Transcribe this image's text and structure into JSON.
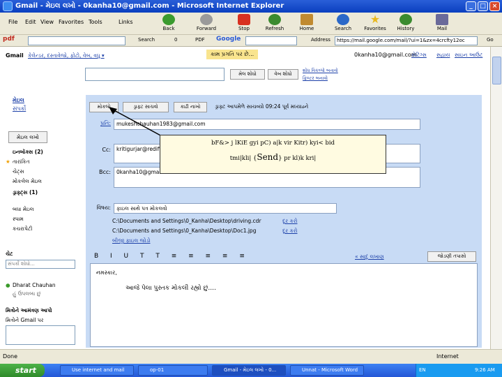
{
  "window": {
    "title": "Gmail - મેઇલ લખો - 0kanha10@gmail.com - Microsoft Internet Explorer",
    "controls": [
      "_",
      "□",
      "×"
    ]
  },
  "menubar": {
    "items": [
      "File",
      "Edit",
      "View",
      "Favorites",
      "Tools",
      "Links"
    ],
    "toolbar": [
      {
        "label": "Back",
        "icon": "back-arrow-icon",
        "color": "#3b9b2f"
      },
      {
        "label": "Forward",
        "icon": "forward-arrow-icon",
        "color": "#9a9a9a"
      },
      {
        "label": "Stop",
        "icon": "stop-icon",
        "color": "#d83020"
      },
      {
        "label": "Refresh",
        "icon": "refresh-icon",
        "color": "#3b8b2f"
      },
      {
        "label": "Home",
        "icon": "home-icon",
        "color": "#c08a30"
      },
      {
        "label": "Search",
        "icon": "search-icon",
        "color": "#2a68c8"
      },
      {
        "label": "Favorites",
        "icon": "favorites-star-icon",
        "color": "#e8b820"
      },
      {
        "label": "History",
        "icon": "history-icon",
        "color": "#3b8b2f"
      },
      {
        "label": "Mail",
        "icon": "mail-icon",
        "color": "#6a6a9a"
      }
    ]
  },
  "googlebar": {
    "pdf_label": "pdf",
    "search_label": "Search",
    "pdf_count": "0",
    "pdf_btn": "PDF",
    "google_label": "Google",
    "address_label": "Address",
    "address_value": "https://mail.google.com/mail/?ui=1&zx=4crcfty12oc",
    "go_label": "Go"
  },
  "gmail_header": {
    "brand": "Gmail",
    "nav": "કેલેન્ડર, દસ્તાવેજો, ફોટો, વેબ, વધુ ▾",
    "loading": "કામ પ્રગતિ પર છે...",
    "account": "0kanha10@gmail.com",
    "links": [
      "સેટિંગ્સ",
      "સહાય",
      "સાઇન આઉટ"
    ],
    "search_mail_btn": "મેલ શોધો",
    "search_web_btn": "વેબ શોધો",
    "search_options": "શોધ વિકલ્પો બતાવો",
    "create_filter": "ફિલ્ટર બનાવો"
  },
  "sidebar": {
    "top": [
      "મેઇલ",
      "સંપર્કો"
    ],
    "compose_btn": "મેઇલ લખો",
    "folders": [
      {
        "label": "ઇનબૉક્સ (2)",
        "bold": true
      },
      {
        "label": "તારાંકિત",
        "icon": "star-icon"
      },
      {
        "label": "ચેટ્સ"
      },
      {
        "label": "મોકલેલ મેઇલ"
      },
      {
        "label": "ડ્રાફ્ટ્સ (1)",
        "bold": true
      },
      {
        "label": "બધા મેઇલ"
      },
      {
        "label": "સ્પામ"
      },
      {
        "label": "કચરાપેટી"
      }
    ],
    "chat_title": "ચેટ",
    "chat_search": "સંપર્કો શોધો...",
    "chat_contacts": [
      {
        "name": "Dharat Chauhan",
        "status": "હું ઉપલબ્ધ છું"
      }
    ],
    "invite_title": "મિત્રોને આમંત્રણ આપો",
    "invite_sub": "મિત્રોને Gmail પર",
    "invite_btn": "આમંત્રણ મોકલો"
  },
  "compose": {
    "send_btn": "મોકલો",
    "save_btn": "ડ્રાફ્ટ સાચવો",
    "discard_btn": "કાઢી નાખો",
    "draft_info": "ડ્રાફ્ટ આપમેળે સાચવ્યો 09:24 પૂર્વ મધ્યાહ્ને",
    "to_label": "પ્રતિ:",
    "to_value": "mukeshchauhan1983@gmail.com",
    "cc_label": "Cc:",
    "cc_value": "kritigurjar@rediffmail.com",
    "bcc_label": "Bcc:",
    "bcc_value": "0kanha10@gmail.com",
    "subject_label": "વિષય:",
    "subject_value": "ફાઇલ સાથે પત્ર મોકલવો",
    "attachments": [
      {
        "path": "C:\\Documents and Settings\\0_Kanha\\Desktop\\driving.cdr",
        "action": "દૂર કરો"
      },
      {
        "path": "C:\\Documents and Settings\\0_Kanha\\Desktop\\Doc1.jpg",
        "action": "દૂર કરો"
      }
    ],
    "attach_more": "બીજી ફાઇલ જોડો",
    "spell_check": "જોડણી તપાસો",
    "plain_text": "« સાદું લખાણ",
    "body_line1": "નમસ્કાર,",
    "body_line2": "આજે પેલા પુસ્તક મોકલી રહ્યો છું...."
  },
  "tooltip": {
    "line1": "bF&> j lKiE gyi pC) a|k vir Kitr) kyi< bid",
    "line2_pre": "tmi|kli| {",
    "line2_send": "Send",
    "line2_post": "} pr kl)k kri|"
  },
  "statusbar": {
    "left": "Done",
    "right": "Internet"
  },
  "taskbar": {
    "start": "start",
    "tasks": [
      "Use internet and mail",
      "op-01",
      "Gmail - મેઇલ લખો - 0...",
      "Unnat - Microsoft Word"
    ],
    "lang": "EN",
    "clock": "9:26 AM"
  },
  "colors": {
    "compose_bg": "#c8dbf5",
    "xp_blue": "#2457d6",
    "link": "#1b3fa8",
    "tooltip_bg": "#fffbe1"
  }
}
